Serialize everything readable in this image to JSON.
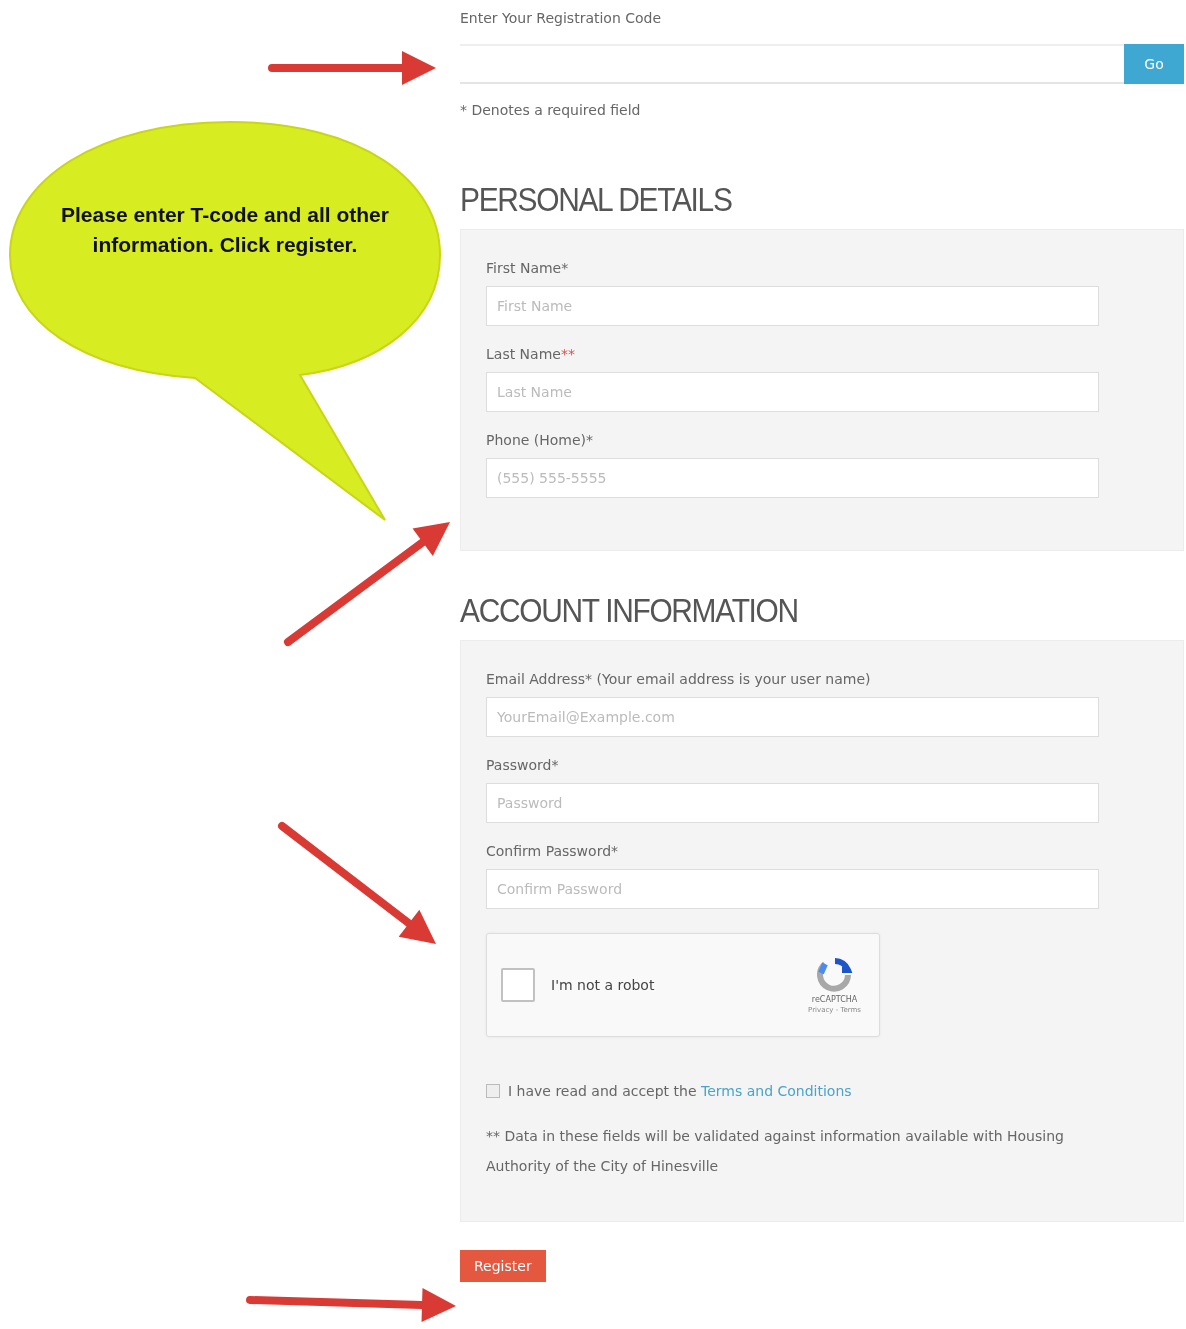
{
  "registration": {
    "label": "Enter Your Registration Code",
    "button": "Go",
    "note": "* Denotes a required field"
  },
  "sections": [
    {
      "heading": "PERSONAL DETAILS",
      "fields": [
        {
          "label": "First Name*",
          "placeholder": "First Name"
        },
        {
          "label": "Last Name",
          "validated_mark": "**",
          "placeholder": "Last Name"
        },
        {
          "label": "Phone (Home)*",
          "placeholder": "(555) 555-5555"
        }
      ]
    },
    {
      "heading": "ACCOUNT INFORMATION",
      "fields": [
        {
          "label": "Email Address* (Your email address is your user name)",
          "placeholder": "YourEmail@Example.com"
        },
        {
          "label": "Password*",
          "placeholder": "Password"
        },
        {
          "label": "Confirm Password*",
          "placeholder": "Confirm Password"
        }
      ],
      "captcha": {
        "label": "I'm not a robot",
        "checked": false,
        "brand": "reCAPTCHA",
        "links": "Privacy - Terms"
      },
      "terms": {
        "checked": false,
        "text": "I have read and accept the ",
        "link": "Terms and Conditions"
      },
      "footnote": "** Data in these fields will be validated against information available with Housing Authority of the City of Hinesville"
    }
  ],
  "submit": "Register",
  "callout": {
    "text": "Please enter T-code and all other information.  Click register."
  }
}
